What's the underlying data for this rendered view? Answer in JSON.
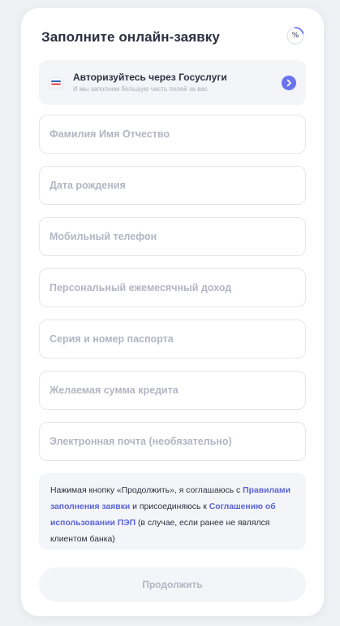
{
  "form": {
    "title": "Заполните онлайн-заявку",
    "progress": {
      "symbol": "%",
      "ring_color": "#6a73ee",
      "track_color": "#e6e8f0"
    }
  },
  "gosuslugi": {
    "title": "Авторизуйтесь через Госуслуги",
    "subtitle": "И мы заполним большую часть полей за вас",
    "logo_icon": "gosuslugi-logo",
    "arrow_icon": "chevron-right",
    "accent": "#6a73ee"
  },
  "fields": {
    "full_name": {
      "placeholder": "Фамилия Имя Отчество",
      "value": ""
    },
    "birth_date": {
      "placeholder": "Дата рождения",
      "value": ""
    },
    "mobile_phone": {
      "placeholder": "Мобильный телефон",
      "value": ""
    },
    "monthly_income": {
      "placeholder": "Персональный ежемесячный доход",
      "value": ""
    },
    "passport": {
      "placeholder": "Серия и номер паспорта",
      "value": ""
    },
    "loan_amount": {
      "placeholder": "Желаемая сумма кредита",
      "value": ""
    },
    "email": {
      "placeholder": "Электронная почта (необязательно)",
      "value": ""
    }
  },
  "consent": {
    "text_1": "Нажимая кнопку «Продолжить», я соглашаюсь с ",
    "link_rules": "Правилами заполнения заявки",
    "text_2": " и присоединяюсь к ",
    "link_pep": "Соглашению об использовании ПЭП",
    "text_3": " (в случае, если ранее не являлся клиентом банка)",
    "link_color": "#5a64d8"
  },
  "submit": {
    "label": "Продолжить",
    "state": "disabled"
  }
}
